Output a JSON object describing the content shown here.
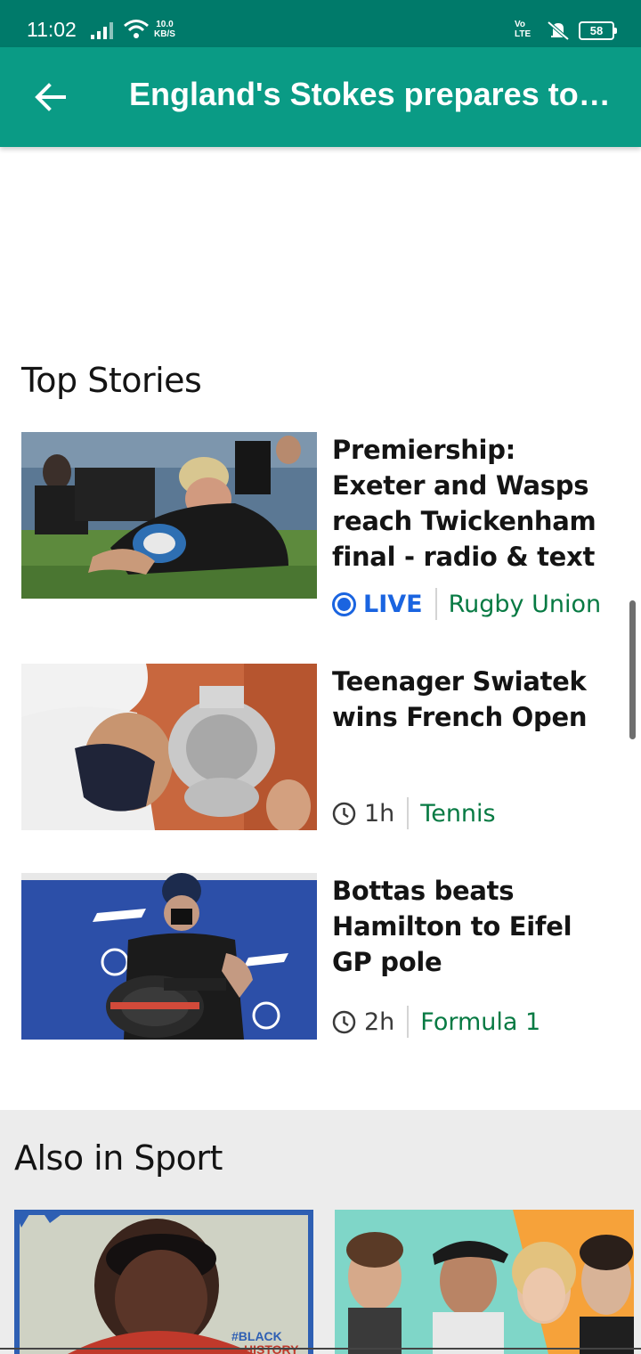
{
  "status_bar": {
    "time": "11:02",
    "speed_value": "10.0",
    "speed_unit": "KB/S",
    "volte_top": "Vo",
    "volte_bottom": "LTE",
    "battery": "58"
  },
  "app_bar": {
    "title": "England's Stokes prepares to…"
  },
  "top_stories": {
    "heading": "Top Stories",
    "items": [
      {
        "headline": "Premiership: Exeter and Wasps reach Twickenham final - radio & text",
        "live_label": "LIVE",
        "topic": "Rugby Union",
        "image": "rugby-player-scoring-try"
      },
      {
        "headline": "Teenager Swiatek wins French Open",
        "time": "1h",
        "topic": "Tennis",
        "image": "player-kissing-trophy"
      },
      {
        "headline": "Bottas beats Hamilton to Eifel GP pole",
        "time": "2h",
        "topic": "Formula 1",
        "image": "driver-with-tyre"
      }
    ]
  },
  "also_in_sport": {
    "heading": "Also in Sport",
    "cards": [
      {
        "image": "footballer-portrait",
        "overlay_line1": "#BLACK",
        "overlay_line2": "HISTORY"
      },
      {
        "image": "group-portrait"
      }
    ]
  },
  "colors": {
    "status_bar": "#007a6a",
    "app_bar": "#0a9b85",
    "live_blue": "#1a64e0",
    "topic_green": "#077a43",
    "section_bg": "#ececec"
  }
}
